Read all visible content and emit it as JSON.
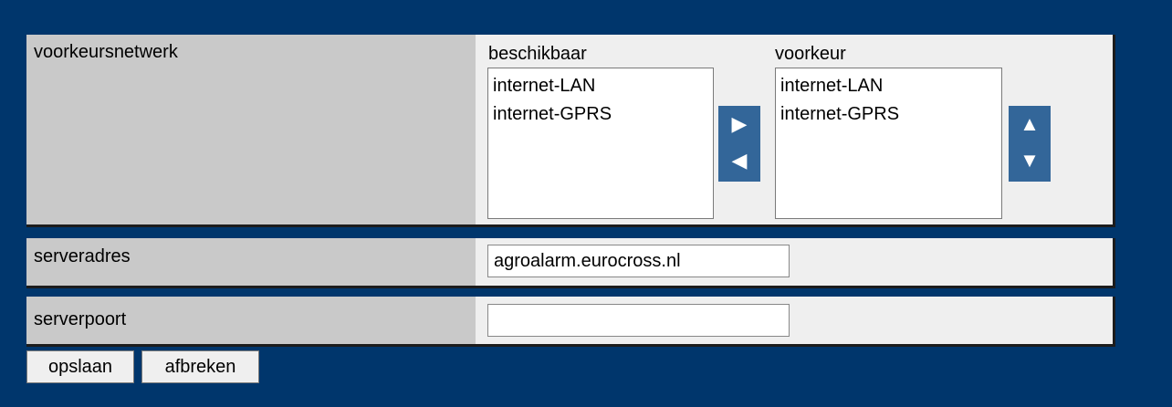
{
  "network": {
    "label": "voorkeursnetwerk",
    "available_title": "beschikbaar",
    "preferred_title": "voorkeur",
    "available_options": [
      "internet-LAN",
      "internet-GPRS"
    ],
    "preferred_options": [
      "internet-LAN",
      "internet-GPRS"
    ],
    "move_right_icon": "▶",
    "move_left_icon": "◀",
    "move_up_icon": "▲",
    "move_down_icon": "▼"
  },
  "server": {
    "label": "serveradres",
    "value": "agroalarm.eurocross.nl"
  },
  "port": {
    "label": "serverpoort",
    "value": ""
  },
  "actions": {
    "save_label": "opslaan",
    "cancel_label": "afbreken"
  },
  "colors": {
    "background": "#00366c",
    "label_cell": "#c9c9c9",
    "value_cell": "#efefef",
    "arrow_button": "#336699"
  }
}
